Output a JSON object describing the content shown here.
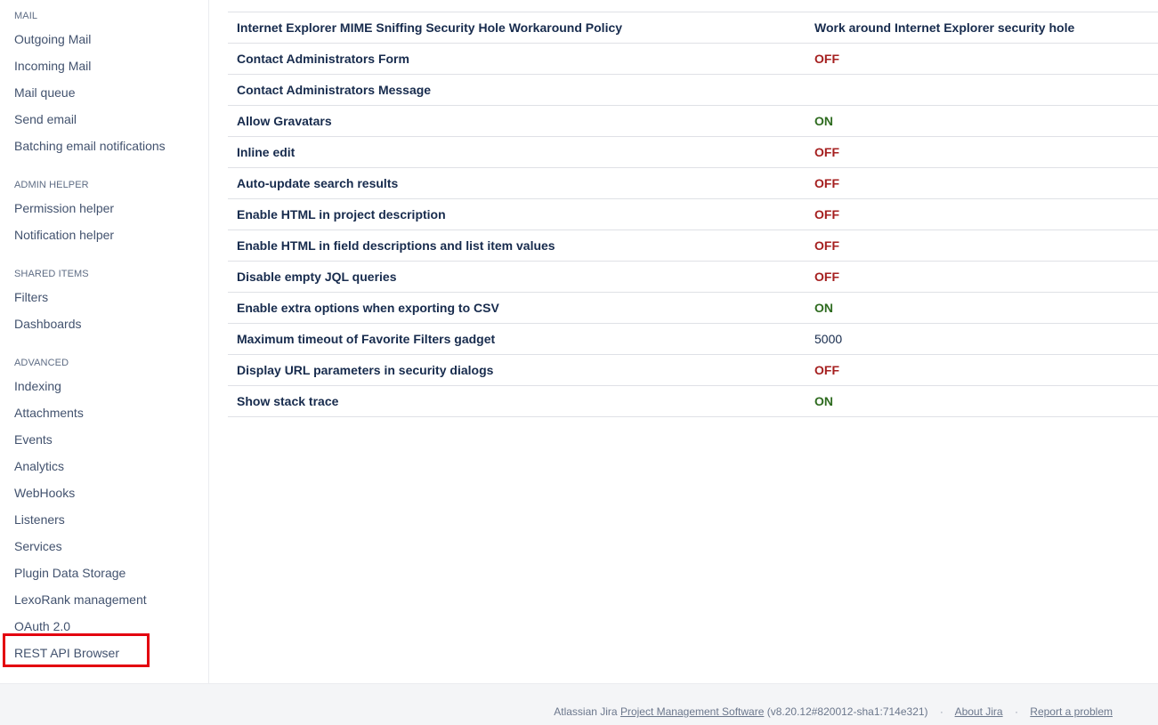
{
  "sidebar": {
    "sections": [
      {
        "heading": "MAIL",
        "items": [
          "Outgoing Mail",
          "Incoming Mail",
          "Mail queue",
          "Send email",
          "Batching email notifications"
        ]
      },
      {
        "heading": "ADMIN HELPER",
        "items": [
          "Permission helper",
          "Notification helper"
        ]
      },
      {
        "heading": "SHARED ITEMS",
        "items": [
          "Filters",
          "Dashboards"
        ]
      },
      {
        "heading": "ADVANCED",
        "items": [
          "Indexing",
          "Attachments",
          "Events",
          "Analytics",
          "WebHooks",
          "Listeners",
          "Services",
          "Plugin Data Storage",
          "LexoRank management",
          "OAuth 2.0",
          "REST API Browser"
        ]
      }
    ]
  },
  "settings": {
    "rows": [
      {
        "label": "Internet Explorer MIME Sniffing Security Hole Workaround Policy",
        "value": "Work around Internet Explorer security hole",
        "status": "text"
      },
      {
        "label": "Contact Administrators Form",
        "value": "OFF",
        "status": "off"
      },
      {
        "label": "Contact Administrators Message",
        "value": "",
        "status": "text"
      },
      {
        "label": "Allow Gravatars",
        "value": "ON",
        "status": "on"
      },
      {
        "label": "Inline edit",
        "value": "OFF",
        "status": "off"
      },
      {
        "label": "Auto-update search results",
        "value": "OFF",
        "status": "off"
      },
      {
        "label": "Enable HTML in project description",
        "value": "OFF",
        "status": "off"
      },
      {
        "label": "Enable HTML in field descriptions and list item values",
        "value": "OFF",
        "status": "off"
      },
      {
        "label": "Disable empty JQL queries",
        "value": "OFF",
        "status": "off"
      },
      {
        "label": "Enable extra options when exporting to CSV",
        "value": "ON",
        "status": "on"
      },
      {
        "label": "Maximum timeout of Favorite Filters gadget",
        "value": "5000",
        "status": "plain"
      },
      {
        "label": "Display URL parameters in security dialogs",
        "value": "OFF",
        "status": "off"
      },
      {
        "label": "Show stack trace",
        "value": "ON",
        "status": "on"
      }
    ]
  },
  "footer": {
    "prefix": "Atlassian Jira",
    "product_link": "Project Management Software",
    "version": "(v8.20.12#820012-sha1:714e321)",
    "separator": "·",
    "about_link": "About Jira",
    "report_link": "Report a problem"
  },
  "colors": {
    "off": "#a51f1f",
    "on": "#2e6b1f",
    "highlight": "#e3000f"
  }
}
